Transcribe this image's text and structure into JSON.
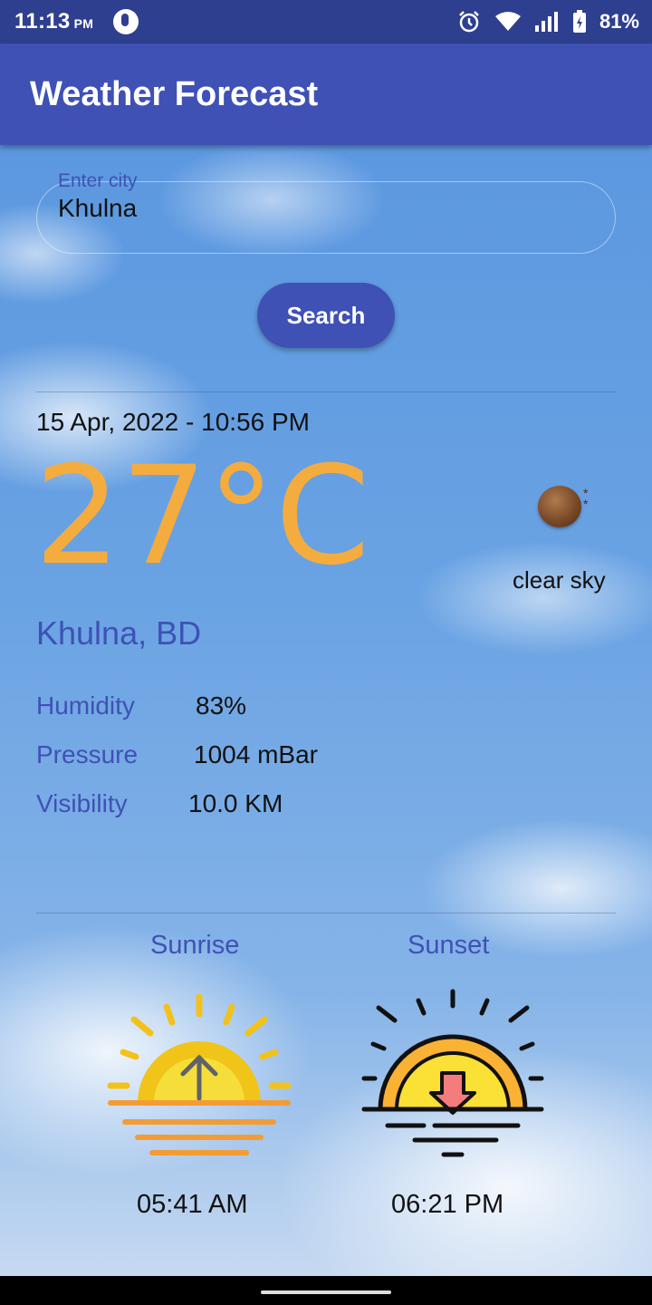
{
  "status_bar": {
    "time": "11:13",
    "ampm": "PM",
    "battery": "81%",
    "icons": [
      "app-notification-icon",
      "alarm-icon",
      "wifi-icon",
      "signal-icon",
      "battery-charging-icon"
    ]
  },
  "app_bar": {
    "title": "Weather Forecast"
  },
  "search": {
    "label": "Enter city",
    "value": "Khulna",
    "button_label": "Search"
  },
  "weather": {
    "datetime": "15 Apr, 2022 - 10:56 PM",
    "temperature": "27°C",
    "icon": "clear-sky-night-icon",
    "description": "clear sky",
    "location": "Khulna, BD",
    "stats": [
      {
        "label": "Humidity",
        "value": "83%"
      },
      {
        "label": "Pressure",
        "value": "1004 mBar"
      },
      {
        "label": "Visibility",
        "value": "10.0 KM"
      }
    ]
  },
  "sun": {
    "sunrise_label": "Sunrise",
    "sunrise_time": "05:41 AM",
    "sunset_label": "Sunset",
    "sunset_time": "06:21 PM"
  },
  "colors": {
    "primary": "#3f51b5",
    "status_bar": "#2f3f8f",
    "temperature": "#f4ac3f"
  }
}
